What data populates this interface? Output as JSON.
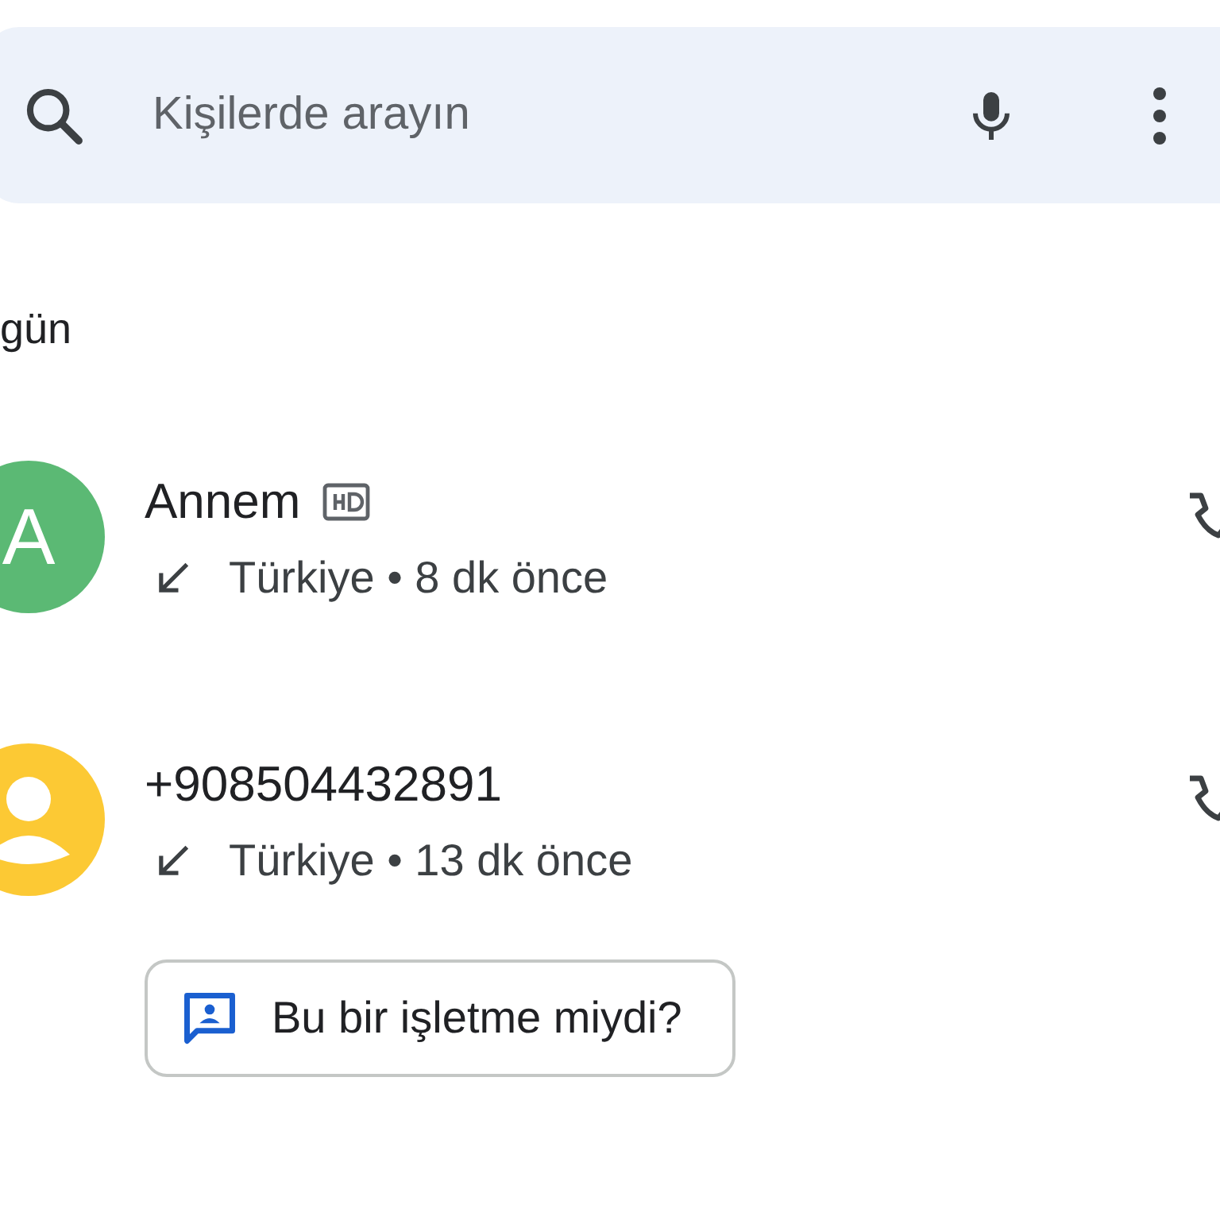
{
  "search": {
    "placeholder": "Kişilerde arayın"
  },
  "section_title": "gün",
  "calls": [
    {
      "avatar": {
        "kind": "letter",
        "letter": "A",
        "color": "#5bb974"
      },
      "name": "Annem",
      "hd": true,
      "incoming": true,
      "detail": "Türkiye • 8 dk önce"
    },
    {
      "avatar": {
        "kind": "person",
        "color": "#fcc934"
      },
      "name": "+908504432891",
      "hd": false,
      "incoming": true,
      "detail": "Türkiye • 13 dk önce",
      "prompt": "Bu bir işletme miydi?"
    }
  ]
}
